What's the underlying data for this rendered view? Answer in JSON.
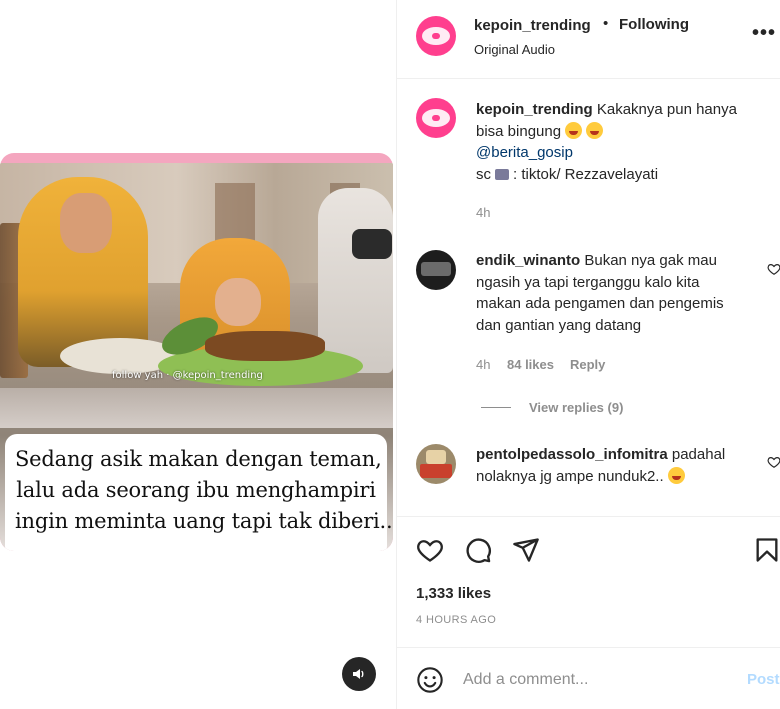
{
  "media": {
    "watermark": "follow yah · @kepoin_trending",
    "caption_lines": [
      "Sedang asik makan dengan teman,",
      "lalu ada seorang ibu menghampiri",
      "ingin meminta uang tapi tak diberi...."
    ],
    "sound_icon": "speaker-icon"
  },
  "header": {
    "username": "kepoin_trending",
    "separator": "•",
    "follow_status": "Following",
    "audio": "Original Audio",
    "more": "•••"
  },
  "caption": {
    "username": "kepoin_trending",
    "text": " Kakaknya pun hanya bisa bingung",
    "mention": "@berita_gosip",
    "source_prefix": "sc",
    "source_text": ": tiktok/ Rezzavelayati",
    "time": "4h"
  },
  "comments": [
    {
      "username": "endik_winanto",
      "text": " Bukan nya gak mau ngasih ya tapi terganggu kalo kita makan ada pengamen dan pengemis dan gantian yang datang",
      "time": "4h",
      "likes": "84 likes",
      "reply": "Reply",
      "view_replies": "View replies (9)"
    },
    {
      "username": "pentolpedassolo_infomitra",
      "text": " padahal nolaknya jg ampe nunduk2..",
      "time": "",
      "likes": "",
      "reply": ""
    }
  ],
  "actions": {
    "likes": "1,333 likes",
    "posted": "4 HOURS AGO"
  },
  "add_comment": {
    "placeholder": "Add a comment...",
    "post_label": "Post"
  },
  "colors": {
    "avatar": "#ff3f8e",
    "link": "#00376b",
    "muted": "#8e8e8e",
    "post_disabled": "#b3dbff",
    "card_border": "#f29ab6"
  }
}
